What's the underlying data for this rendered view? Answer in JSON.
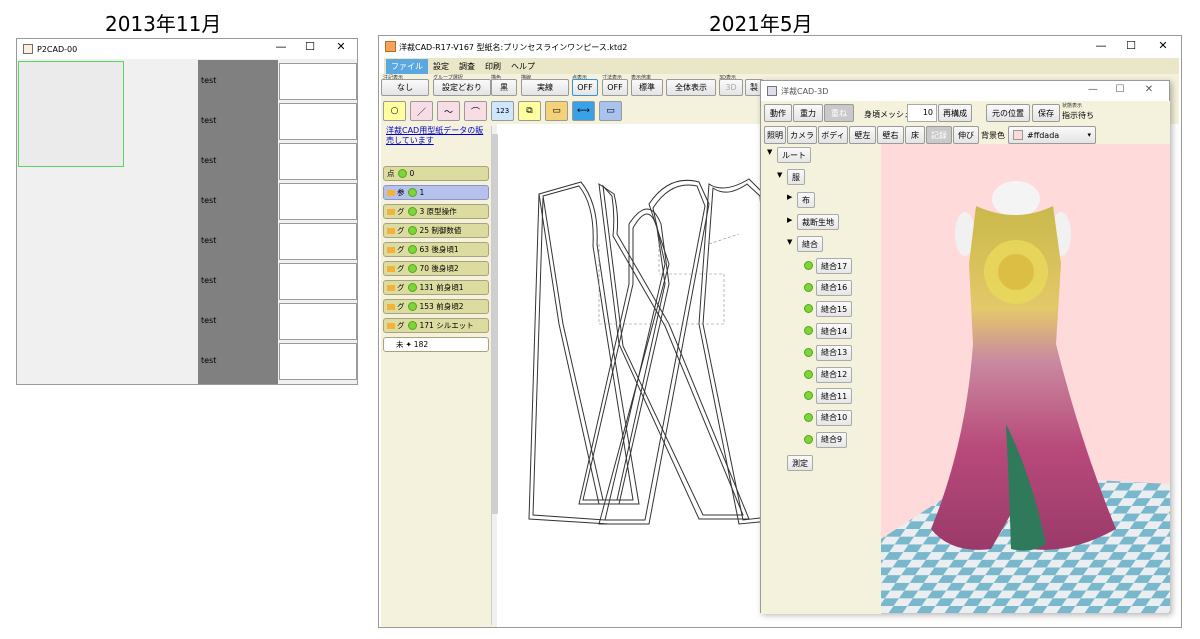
{
  "captions": {
    "left": "2013年11月",
    "right": "2021年5月"
  },
  "win1": {
    "title": "P2CAD-00",
    "rows": [
      "test",
      "test",
      "test",
      "test",
      "test",
      "test",
      "test",
      "test"
    ]
  },
  "win2": {
    "title": "洋裁CAD-R17-V167 型紙名:プリンセスラインワンピース.ktd2",
    "menu": [
      "ファイル",
      "設定",
      "調査",
      "印刷",
      "ヘルプ"
    ],
    "toolbar": [
      {
        "top": "注記表示",
        "label": "なし"
      },
      {
        "top": "グループ選択",
        "label": "設定どおり"
      },
      {
        "top": "描色",
        "label": "黒"
      },
      {
        "top": "描線",
        "label": "実線"
      },
      {
        "top": "点表示",
        "label": "OFF"
      },
      {
        "top": "寸法表示",
        "label": "OFF"
      },
      {
        "top": "表示倍率",
        "label": "標準"
      },
      {
        "top": "",
        "label": "全体表示"
      },
      {
        "top": "3D表示",
        "label": "3D"
      },
      {
        "top": "",
        "label": "製"
      }
    ],
    "tools": [
      "○",
      "／",
      "〜",
      "⌒",
      "123",
      "⧉",
      "▭",
      "⟷",
      "▭"
    ],
    "link": "洋裁CAD用型紙データの販売しています",
    "list": [
      {
        "t": "点",
        "n": "0"
      },
      {
        "t": "参",
        "n": "1"
      },
      {
        "t": "グ",
        "n": "3 原型操作"
      },
      {
        "t": "グ",
        "n": "25 制御数値"
      },
      {
        "t": "グ",
        "n": "63 後身頃1"
      },
      {
        "t": "グ",
        "n": "70 後身頃2"
      },
      {
        "t": "グ",
        "n": "131 前身頃1"
      },
      {
        "t": "グ",
        "n": "153 前身頃2"
      },
      {
        "t": "グ",
        "n": "171 シルエット"
      },
      {
        "t": "未",
        "n": "182"
      }
    ]
  },
  "win3": {
    "title": "洋裁CAD-3D",
    "row1": {
      "b1": "動作",
      "b2": "重力",
      "b3": "重ね",
      "mesh_label": "身頃メッシュ",
      "mesh": "10",
      "b4": "再構成",
      "b5": "元の位置",
      "b6": "保存",
      "status_top": "状態表示",
      "status": "指示待ち"
    },
    "row2": {
      "b1": "照明",
      "b2": "カメラ",
      "b3": "ボディ",
      "b4": "壁左",
      "b5": "壁右",
      "b6": "床",
      "b7": "記録",
      "b8": "伸び",
      "bg_label": "背景色",
      "bg": "#ffdada"
    },
    "tree": {
      "root": "ルート",
      "clothes": "服",
      "cloth": "布",
      "cut": "裁断生地",
      "seam": "縫合",
      "seams": [
        "縫合17",
        "縫合16",
        "縫合15",
        "縫合14",
        "縫合13",
        "縫合12",
        "縫合11",
        "縫合10",
        "縫合9"
      ],
      "measure": "測定"
    }
  }
}
